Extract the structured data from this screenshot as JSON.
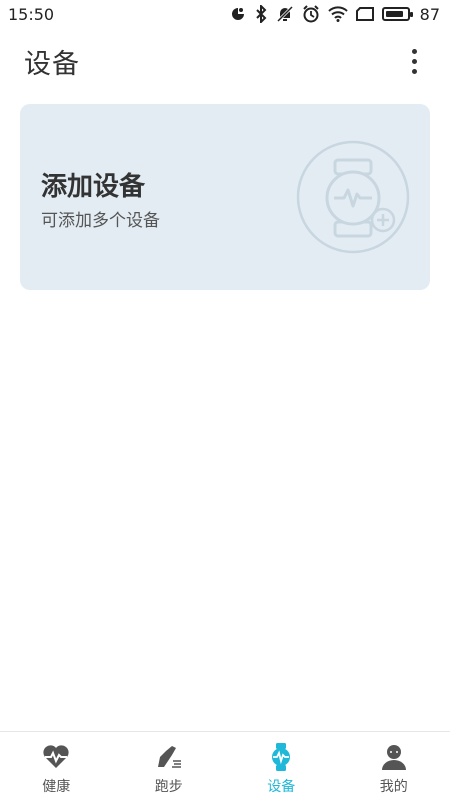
{
  "status_bar": {
    "time": "15:50",
    "battery_level": "87",
    "icons": [
      "notification-icon",
      "bluetooth-icon",
      "mute-icon",
      "alarm-icon",
      "wifi-icon",
      "screen-icon",
      "battery-icon"
    ]
  },
  "header": {
    "title": "设备",
    "menu_icon": "more-vert-icon"
  },
  "add_device_card": {
    "title": "添加设备",
    "subtitle": "可添加多个设备",
    "icon": "watch-add-icon"
  },
  "bottom_nav": {
    "active_color": "#1fb8d8",
    "items": [
      {
        "label": "健康",
        "icon": "heart-pulse-icon",
        "active": false
      },
      {
        "label": "跑步",
        "icon": "running-shoe-icon",
        "active": false
      },
      {
        "label": "设备",
        "icon": "watch-icon",
        "active": true
      },
      {
        "label": "我的",
        "icon": "person-icon",
        "active": false
      }
    ]
  }
}
